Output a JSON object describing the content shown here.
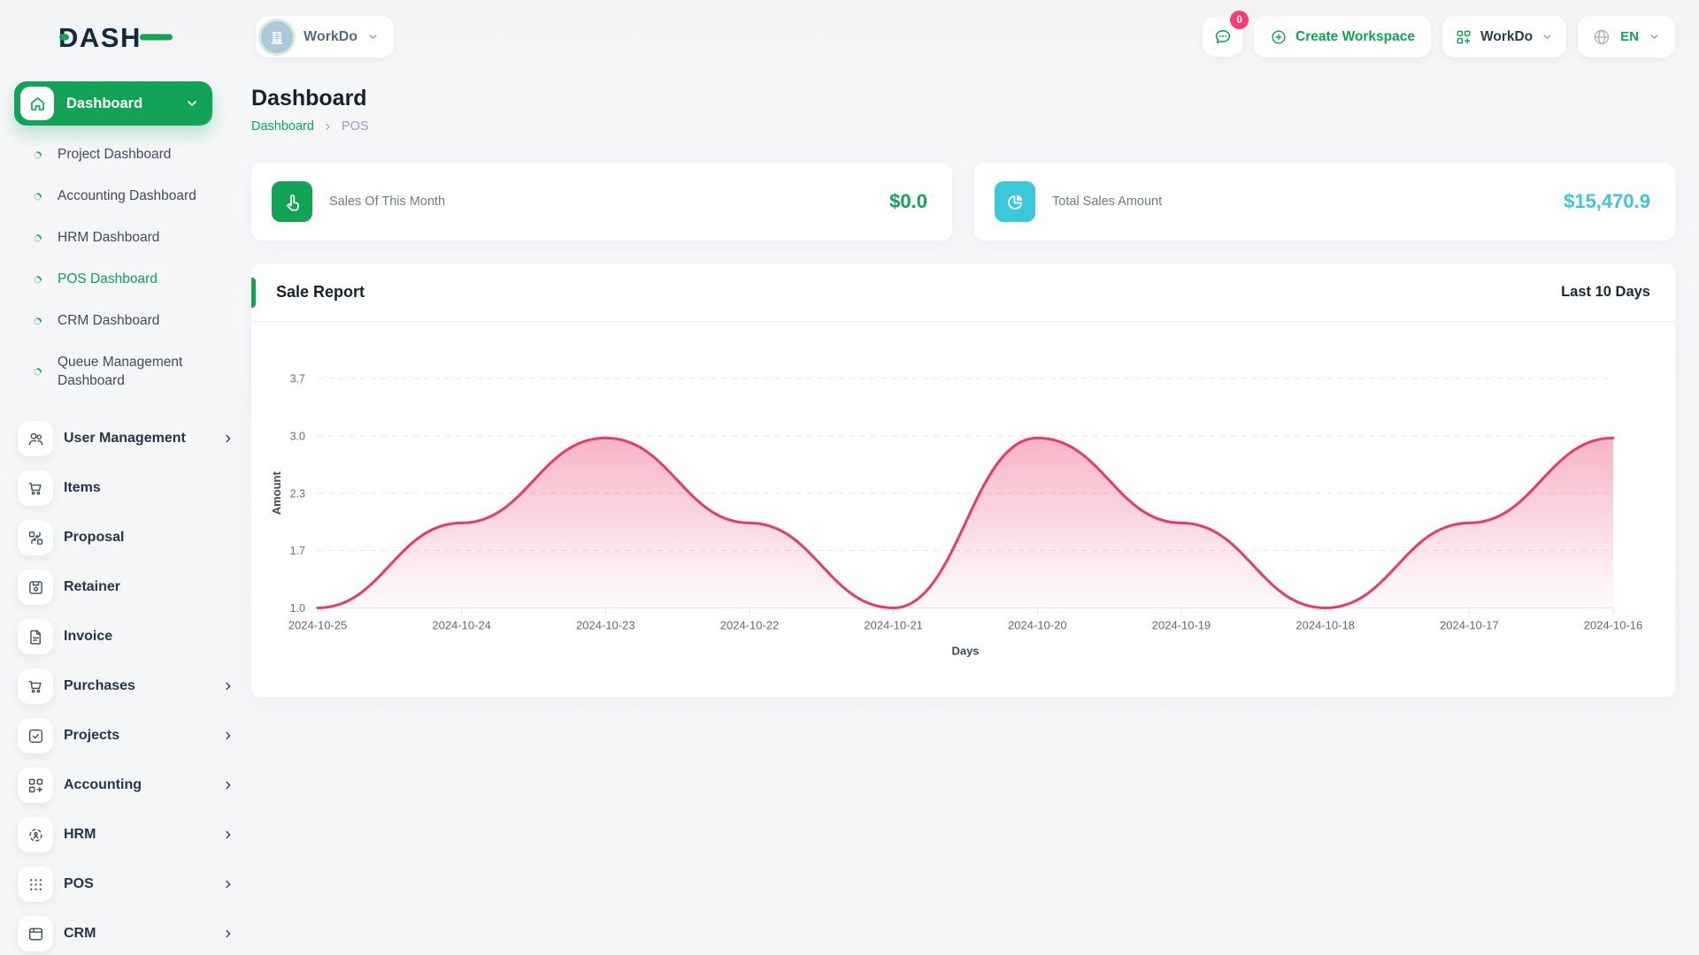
{
  "app": {
    "logo_text": "DASH"
  },
  "header": {
    "workspace_chip": {
      "label": "WorkDo"
    },
    "messages_badge": "0",
    "create_workspace": {
      "label": "Create Workspace"
    },
    "workspace_menu": {
      "label": "WorkDo"
    },
    "language_menu": {
      "label": "EN"
    }
  },
  "sidebar": {
    "dashboard_group": {
      "label": "Dashboard"
    },
    "sub_items": [
      {
        "label": "Project Dashboard",
        "active": false
      },
      {
        "label": "Accounting Dashboard",
        "active": false
      },
      {
        "label": "HRM Dashboard",
        "active": false
      },
      {
        "label": "POS Dashboard",
        "active": true
      },
      {
        "label": "CRM Dashboard",
        "active": false
      },
      {
        "label": "Queue Management Dashboard",
        "active": false
      }
    ],
    "menu_items": [
      {
        "label": "User Management",
        "icon": "users",
        "expandable": true
      },
      {
        "label": "Items",
        "icon": "cart",
        "expandable": false
      },
      {
        "label": "Proposal",
        "icon": "proposal",
        "expandable": false
      },
      {
        "label": "Retainer",
        "icon": "retainer",
        "expandable": false
      },
      {
        "label": "Invoice",
        "icon": "invoice",
        "expandable": false
      },
      {
        "label": "Purchases",
        "icon": "cart",
        "expandable": true
      },
      {
        "label": "Projects",
        "icon": "projects",
        "expandable": true
      },
      {
        "label": "Accounting",
        "icon": "grid-plus",
        "expandable": true
      },
      {
        "label": "HRM",
        "icon": "hrm",
        "expandable": true
      },
      {
        "label": "POS",
        "icon": "pos-grid",
        "expandable": true
      },
      {
        "label": "CRM",
        "icon": "crm",
        "expandable": true
      }
    ]
  },
  "page": {
    "title": "Dashboard",
    "breadcrumb": {
      "root": "Dashboard",
      "current": "POS"
    }
  },
  "stat_cards": [
    {
      "label": "Sales Of This Month",
      "value": "$0.0",
      "icon": "hand-click",
      "accent": "#12a357"
    },
    {
      "label": "Total Sales Amount",
      "value": "$15,470.9",
      "icon": "pie-chart",
      "accent": "#3cc7da"
    }
  ],
  "sale_report": {
    "title": "Sale Report",
    "range_label": "Last 10 Days"
  },
  "chart_data": {
    "type": "area",
    "title": "Sale Report",
    "x": [
      "2024-10-25",
      "2024-10-24",
      "2024-10-23",
      "2024-10-22",
      "2024-10-21",
      "2024-10-20",
      "2024-10-19",
      "2024-10-18",
      "2024-10-17",
      "2024-10-16"
    ],
    "series": [
      {
        "name": "Amount",
        "values": [
          1.0,
          2.0,
          3.0,
          2.0,
          1.0,
          3.0,
          2.0,
          1.0,
          2.0,
          3.0
        ]
      }
    ],
    "xlabel": "Days",
    "ylabel": "Amount",
    "ylim": [
      1.0,
      3.7
    ],
    "yticks": [
      3.7,
      3.0,
      2.3,
      1.7,
      1.0
    ],
    "grid": true,
    "legend": false,
    "curve": "smooth",
    "line_color": "#ea3a6a",
    "fill": "pink-gradient"
  },
  "colors": {
    "primary": "#12a357",
    "cyan": "#3cc7da",
    "line_pink": "#ea3a6a",
    "badge_pink": "#fb3b6f"
  }
}
